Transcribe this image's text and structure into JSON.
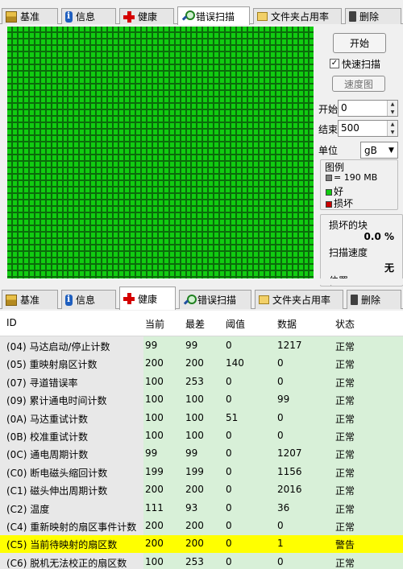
{
  "top_tabs": {
    "labels": [
      "基准",
      "信息",
      "健康",
      "错误扫描",
      "文件夹占用率",
      "删除"
    ],
    "active": "错误扫描"
  },
  "scan_panel": {
    "start_button": "开始",
    "quick_scan_label": "快速扫描",
    "quick_scan_checked": true,
    "speed_map_button": "速度图",
    "start_label": "开始",
    "start_value": "0",
    "end_label": "结束",
    "end_value": "500",
    "unit_label": "单位",
    "unit_value": "gB",
    "legend_title": "图例",
    "legend_block": "= 190 MB",
    "legend_good": "好",
    "legend_bad": "损坏",
    "damaged_blocks_label": "损坏的块",
    "damaged_blocks_value": "0.0 %",
    "scan_speed_label": "扫描速度",
    "scan_speed_value": "无",
    "position_label": "位置"
  },
  "colors": {
    "grid_good": "#11cc11",
    "grid_lines": "#0b6b0b",
    "legend_block": "#808080",
    "legend_good": "#11cc11",
    "legend_bad": "#cc0000",
    "warning_row": "#ffff00"
  },
  "bottom_tabs": {
    "labels": [
      "基准",
      "信息",
      "健康",
      "错误扫描",
      "文件夹占用率",
      "删除"
    ],
    "active": "健康"
  },
  "smart_table": {
    "headers": [
      "ID",
      "当前",
      "最差",
      "阈值",
      "数据",
      "状态"
    ],
    "rows": [
      [
        "(04) 马达启动/停止计数",
        "99",
        "99",
        "0",
        "1217",
        "正常"
      ],
      [
        "(05) 重映射扇区计数",
        "200",
        "200",
        "140",
        "0",
        "正常"
      ],
      [
        "(07) 寻道错误率",
        "100",
        "253",
        "0",
        "0",
        "正常"
      ],
      [
        "(09) 累计通电时间计数",
        "100",
        "100",
        "0",
        "99",
        "正常"
      ],
      [
        "(0A) 马达重试计数",
        "100",
        "100",
        "51",
        "0",
        "正常"
      ],
      [
        "(0B) 校准重试计数",
        "100",
        "100",
        "0",
        "0",
        "正常"
      ],
      [
        "(0C) 通电周期计数",
        "99",
        "99",
        "0",
        "1207",
        "正常"
      ],
      [
        "(C0) 断电磁头缩回计数",
        "199",
        "199",
        "0",
        "1156",
        "正常"
      ],
      [
        "(C1) 磁头伸出周期计数",
        "200",
        "200",
        "0",
        "2016",
        "正常"
      ],
      [
        "(C2) 温度",
        "111",
        "93",
        "0",
        "36",
        "正常"
      ],
      [
        "(C4) 重新映射的扇区事件计数",
        "200",
        "200",
        "0",
        "0",
        "正常"
      ],
      [
        "(C5) 当前待映射的扇区数",
        "200",
        "200",
        "0",
        "1",
        "警告"
      ],
      [
        "(C6) 脱机无法校正的扇区数",
        "100",
        "253",
        "0",
        "0",
        "正常"
      ]
    ],
    "highlighted_row": 11
  }
}
